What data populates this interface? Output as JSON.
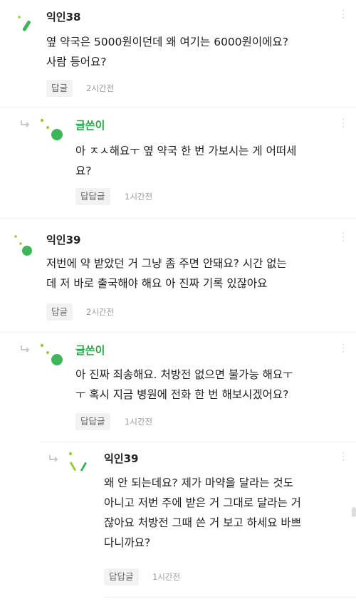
{
  "comments": [
    {
      "author": "익인38",
      "body": "옆 약국은 5000원이던데 왜 여기는 6000원이에요?\n사람 등어요?",
      "reply_label": "답글",
      "time": "2시간전"
    },
    {
      "author": "글쓴이",
      "body": "아 ㅈㅅ해요ㅜ 옆 약국 한 번 가보시는 게 어떠세\n요?",
      "reply_label": "답답글",
      "time": "1시간전"
    },
    {
      "author": "익인39",
      "body": "저번에 약 받았던 거 그냥 좀 주면 안돼요? 시간 없는\n데 저 바로 출국해야 해요 아 진짜 기록 있잖아요",
      "reply_label": "답글",
      "time": "2시간전"
    },
    {
      "author": "글쓴이",
      "body": "아 진짜 죄송해요. 처방전 없으면 불가능 해요ㅜ\nㅜ 혹시 지금 병원에 전화 한 번 해보시겠어요?",
      "reply_label": "답답글",
      "time": "1시간전"
    },
    {
      "author": "익인39",
      "body": "왜 안 되는데요? 제가 마약을 달라는 것도\n아니고 저번 주에 받은 거 그대로 달라는 거\n잖아요 처방전 그때 쓴 거 보고 하세요 바쁘\n다니까요?",
      "reply_label": "답답글",
      "time": "1시간전"
    }
  ],
  "colors": {
    "op_green": "#2aa345",
    "avatar_green": "#3cb55b",
    "avatar_lime": "#9acd32",
    "muted": "#9a9a9a"
  },
  "icons": [
    "reply-arrow-icon",
    "more-options-icon",
    "avatar-icon"
  ]
}
